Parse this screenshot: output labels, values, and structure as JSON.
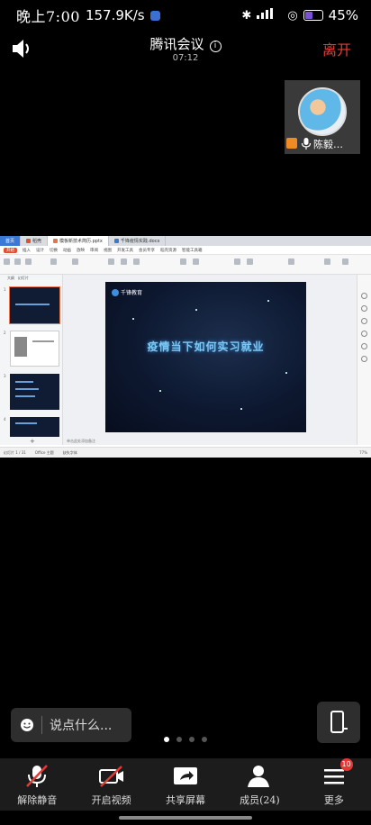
{
  "status_bar": {
    "time": "晚上7:00",
    "network_speed": "157.9K/s",
    "battery": "45%",
    "battery_level": 0.45
  },
  "meeting": {
    "title": "腾讯会议",
    "timer": "07:12",
    "leave_label": "离开"
  },
  "participant": {
    "name": "陈毅…"
  },
  "shared_screen": {
    "tabs": [
      "首页",
      "稻壳",
      "模板新技术简历.pptx",
      "千锋疫情实践.docx"
    ],
    "menu": [
      "开始",
      "插入",
      "设计",
      "切换",
      "动画",
      "放映",
      "审阅",
      "视图",
      "开发工具",
      "会员专享",
      "稻壳资源",
      "智能工具箱"
    ],
    "panel_tabs": [
      "大纲",
      "幻灯片"
    ],
    "slide_numbers": [
      "1",
      "2",
      "3",
      "4"
    ],
    "slide_logo": "千锋教育",
    "slide_headline": "疫情当下如何实习就业",
    "notes_placeholder": "单击此处添加备注",
    "status_left": "幻灯片 1 / 31",
    "status_theme": "Office 主题",
    "status_font": "缺失字体",
    "status_zoom": "77%"
  },
  "chat": {
    "placeholder": "说点什么..."
  },
  "pager": {
    "count": 4,
    "active": 1
  },
  "toolbar": {
    "mute_label": "解除静音",
    "video_label": "开启视频",
    "share_label": "共享屏幕",
    "members_label": "成员(24)",
    "more_label": "更多",
    "more_badge": "10"
  }
}
